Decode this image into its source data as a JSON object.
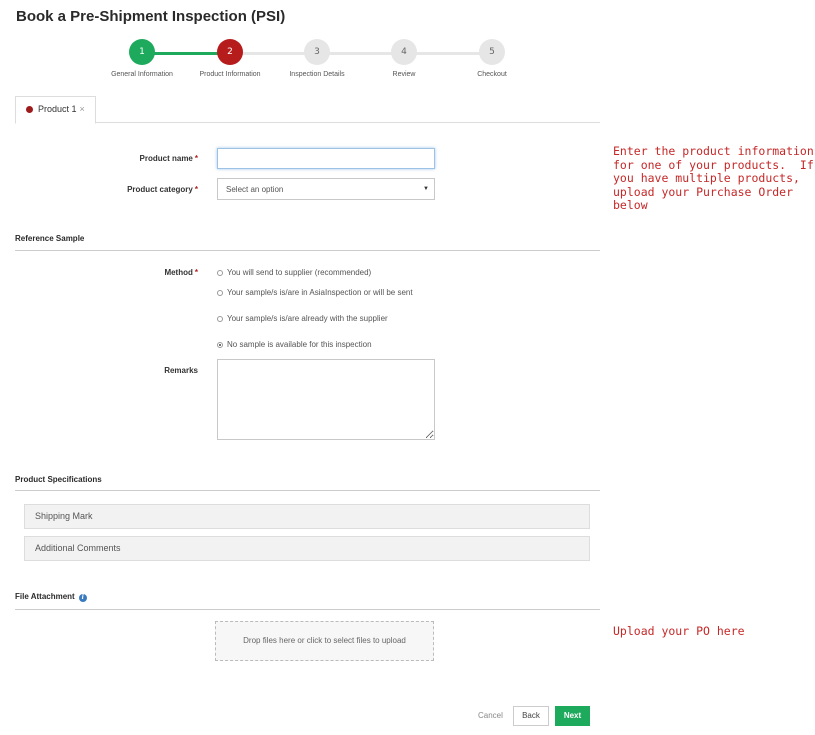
{
  "page": {
    "title": "Book a Pre-Shipment Inspection (PSI)"
  },
  "stepper": {
    "steps": [
      {
        "number": "1",
        "label": "General Information",
        "state": "done"
      },
      {
        "number": "2",
        "label": "Product Information",
        "state": "current"
      },
      {
        "number": "3",
        "label": "Inspection Details",
        "state": "todo"
      },
      {
        "number": "4",
        "label": "Review",
        "state": "todo"
      },
      {
        "number": "5",
        "label": "Checkout",
        "state": "todo"
      }
    ],
    "colors": {
      "done": "#1eaa5c",
      "current": "#b71c1c",
      "todo": "#e6e6e6"
    }
  },
  "tabs": [
    {
      "label": "Product 1",
      "close_icon": "×",
      "status_color": "#9e1b1b"
    }
  ],
  "product": {
    "name_label": "Product name",
    "name_value": "",
    "category_label": "Product category",
    "category_selected": "Select an option",
    "required_mark": "*"
  },
  "reference_sample": {
    "title": "Reference Sample",
    "method_label": "Method",
    "options": [
      {
        "label": "You will send to supplier (recommended)",
        "checked": false
      },
      {
        "label": "Your sample/s is/are in AsiaInspection or will be sent",
        "checked": false
      },
      {
        "label": "Your sample/s is/are already with the supplier",
        "checked": false
      },
      {
        "label": "No sample is available for this inspection",
        "checked": true
      }
    ],
    "remarks_label": "Remarks",
    "remarks_value": ""
  },
  "specifications": {
    "title": "Product Specifications",
    "panels": [
      "Shipping Mark",
      "Additional Comments"
    ]
  },
  "attachment": {
    "title": "File Attachment",
    "info_icon": "info-icon",
    "dropzone_text": "Drop files here or click to select files to upload"
  },
  "actions": {
    "cancel": "Cancel",
    "back": "Back",
    "next": "Next"
  },
  "annotations": {
    "product_info_note": "Enter the product information\nfor one of your products.  If\nyou have multiple products,\nupload your Purchase Order\nbelow",
    "upload_note": "Upload your PO here",
    "color": "#c62828"
  }
}
